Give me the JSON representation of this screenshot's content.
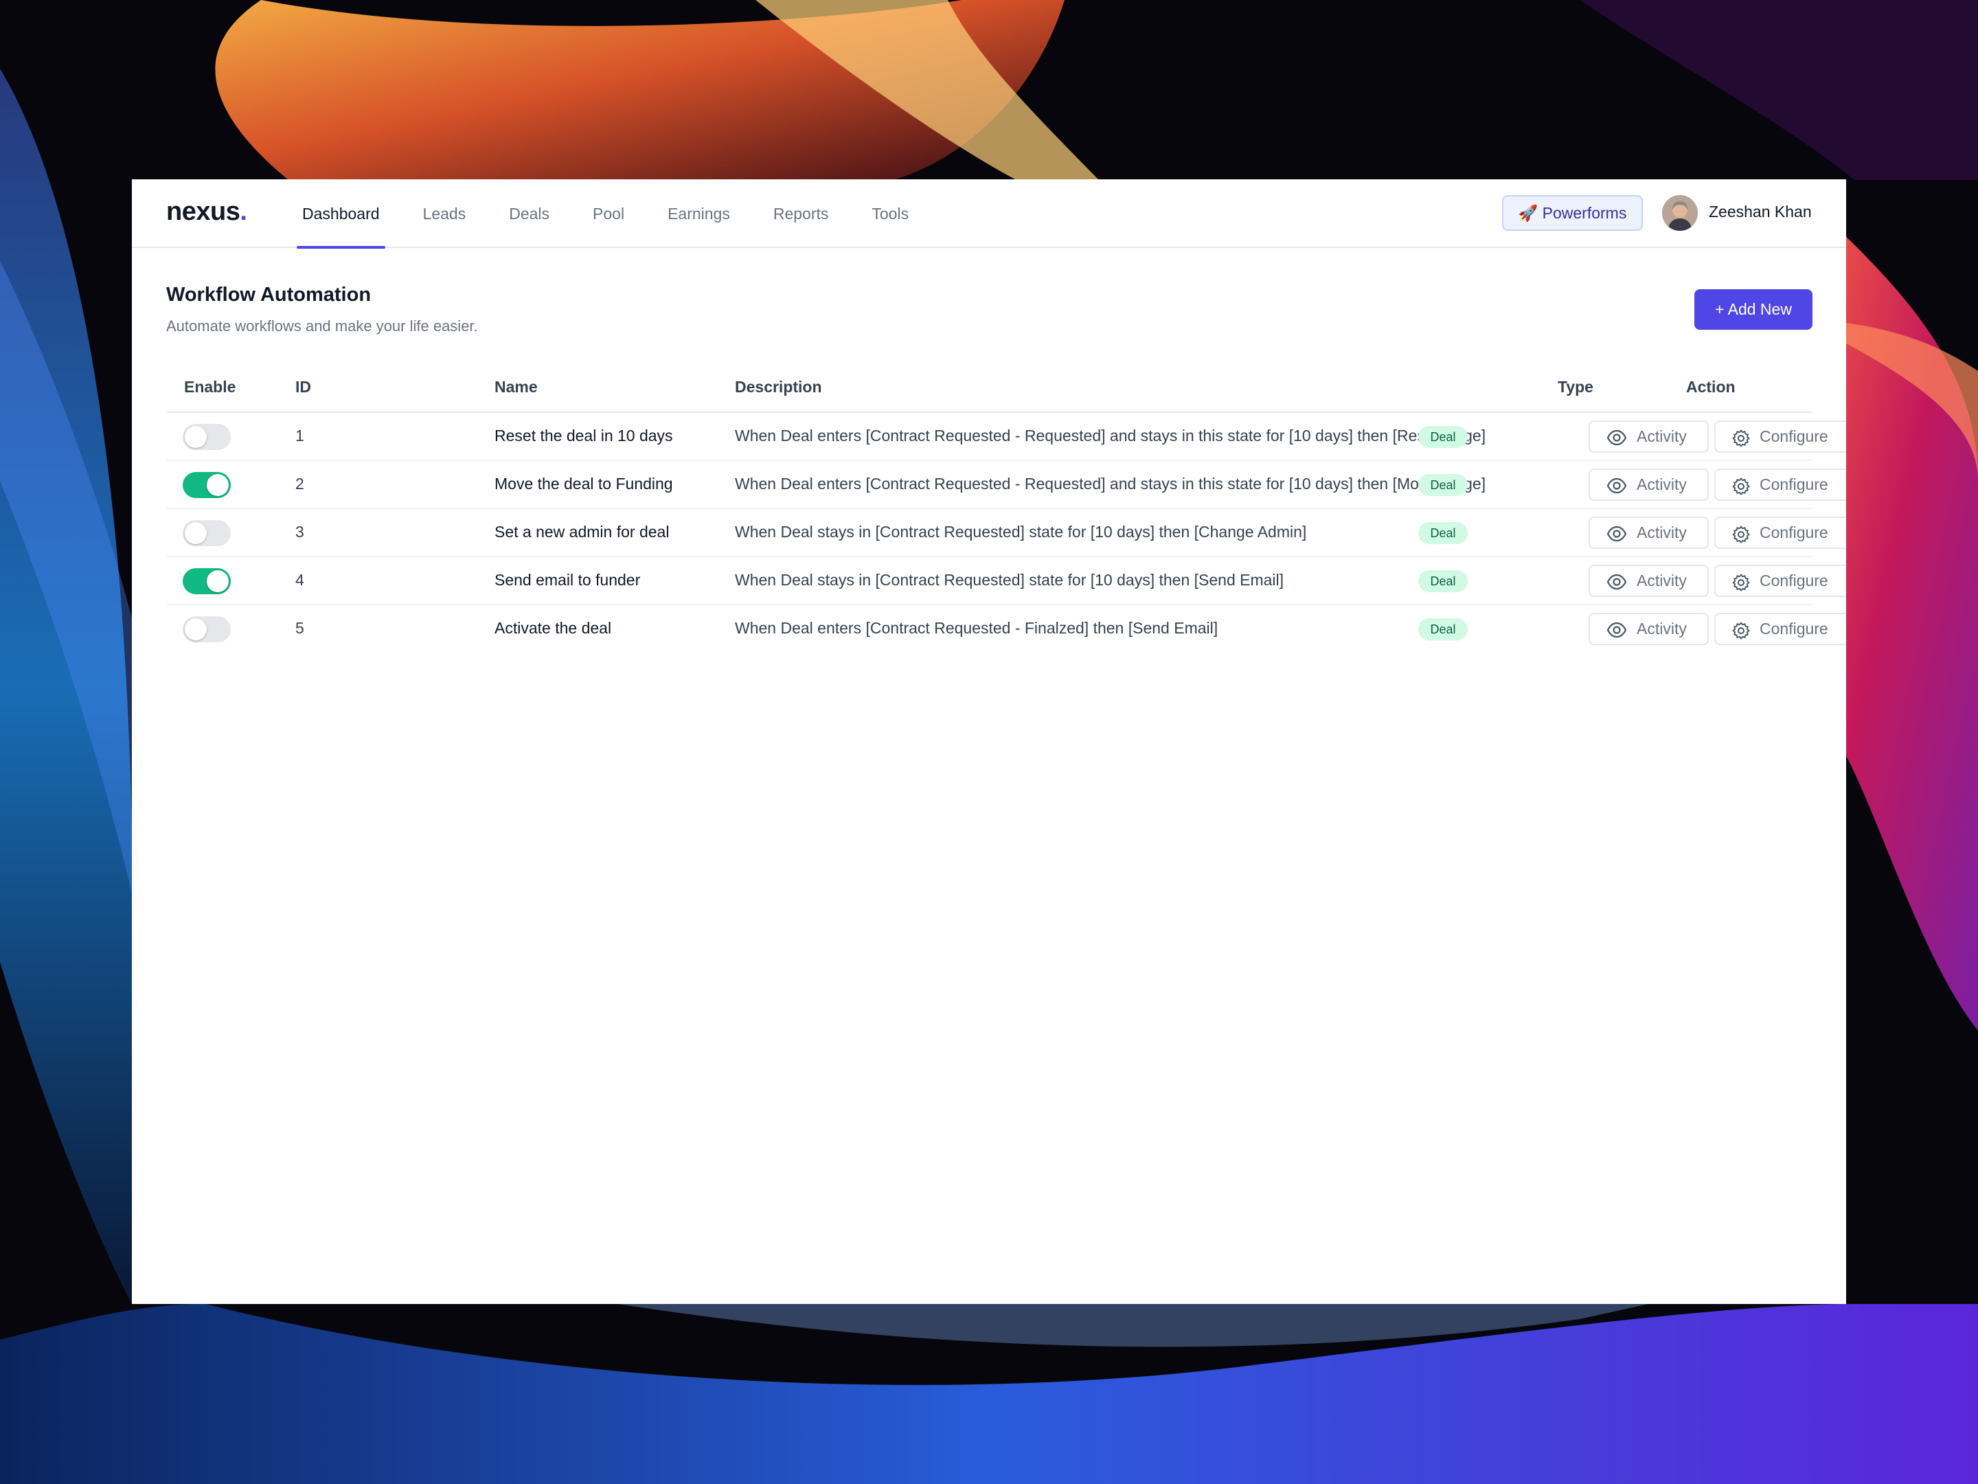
{
  "app": {
    "logo": "nexus",
    "logo_dot": ".",
    "nav": [
      {
        "label": "Dashboard",
        "active": true
      },
      {
        "label": "Leads",
        "active": false
      },
      {
        "label": "Deals",
        "active": false
      },
      {
        "label": "Pool",
        "active": false
      },
      {
        "label": "Earnings",
        "active": false
      },
      {
        "label": "Reports",
        "active": false
      },
      {
        "label": "Tools",
        "active": false
      }
    ],
    "powerforms_label": "🚀 Powerforms",
    "user_name": "Zeeshan Khan"
  },
  "page": {
    "title": "Workflow Automation",
    "subtitle": "Automate workflows and make your life easier.",
    "add_button": "+ Add New"
  },
  "table": {
    "columns": {
      "enable": "Enable",
      "id": "ID",
      "name": "Name",
      "description": "Description",
      "type": "Type",
      "action": "Action"
    },
    "rows": [
      {
        "enabled": false,
        "id": "1",
        "name": "Reset the deal in 10 days",
        "description": "When Deal enters [Contract Requested - Requested] and stays in this state for [10 days] then [Reset stage]",
        "type": "Deal",
        "activity": "Activity",
        "configure": "Configure"
      },
      {
        "enabled": true,
        "id": "2",
        "name": "Move the deal to Funding",
        "description": "When Deal enters [Contract Requested - Requested] and stays in this state for [10 days] then [Move Stage]",
        "type": "Deal",
        "activity": "Activity",
        "configure": "Configure"
      },
      {
        "enabled": false,
        "id": "3",
        "name": "Set a new admin for deal",
        "description": "When Deal stays in [Contract Requested] state for [10 days] then [Change Admin]",
        "type": "Deal",
        "activity": "Activity",
        "configure": "Configure"
      },
      {
        "enabled": true,
        "id": "4",
        "name": "Send email to funder",
        "description": "When Deal stays in [Contract Requested] state for [10 days] then [Send Email]",
        "type": "Deal",
        "activity": "Activity",
        "configure": "Configure"
      },
      {
        "enabled": false,
        "id": "5",
        "name": "Activate the deal",
        "description": "When Deal enters [Contract Requested - Finalzed] then [Send Email]",
        "type": "Deal",
        "activity": "Activity",
        "configure": "Configure"
      }
    ]
  },
  "colors": {
    "accent": "#4f46e5",
    "toggle_on": "#10b981",
    "badge_bg": "#d1fae5"
  },
  "icons": {
    "activity": "eye-icon",
    "configure": "gear-icon",
    "powerforms": "rocket-icon"
  }
}
